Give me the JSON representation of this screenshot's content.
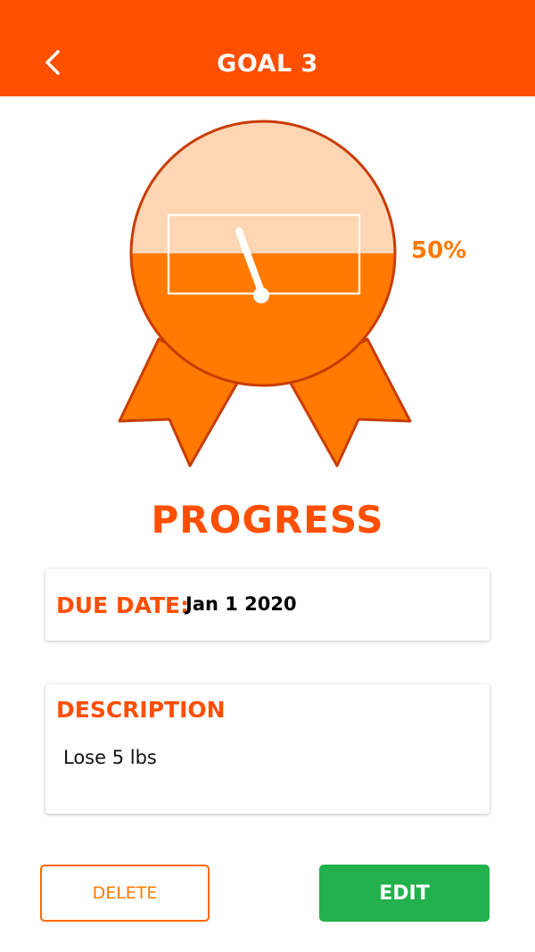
{
  "header": {
    "title": "GOAL 3",
    "back_icon": "chevron-left-icon",
    "background_color": "#ff4f00"
  },
  "progress": {
    "percent_label": "50%",
    "fraction": 0.5,
    "heading": "PROGRESS",
    "fill_color": "#ff7a00",
    "empty_color": "#ffd6b3"
  },
  "due_date": {
    "label": "DUE DATE:",
    "value": "Jan 1 2020"
  },
  "description": {
    "label": "DESCRIPTION",
    "value": "Lose 5 lbs"
  },
  "actions": {
    "delete_label": "DELETE",
    "edit_label": "EDIT",
    "edit_color": "#22b14c"
  }
}
